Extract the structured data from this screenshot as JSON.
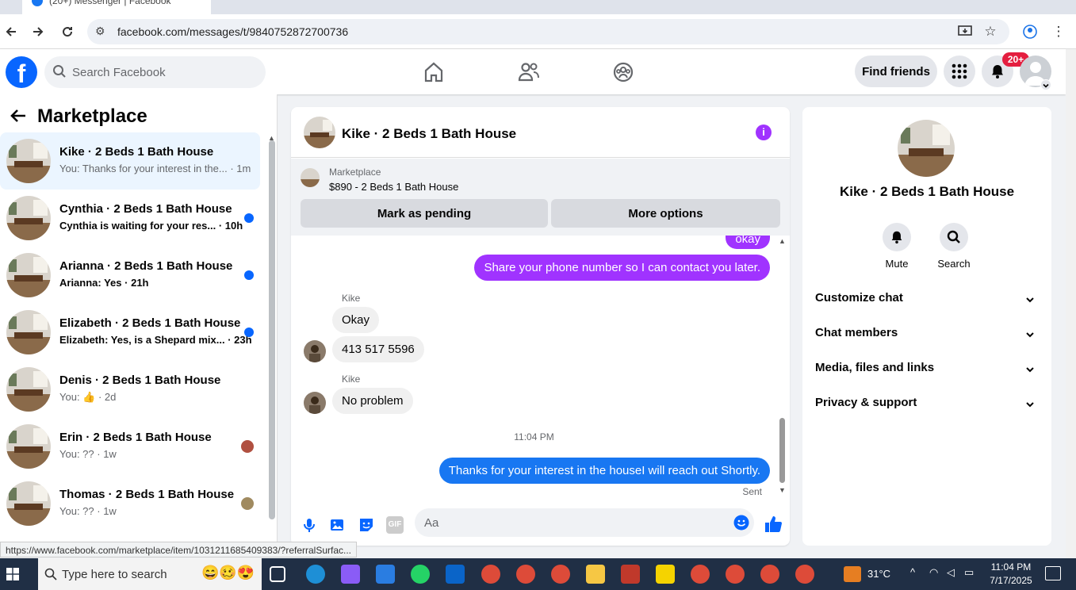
{
  "browser": {
    "tab_title": "(20+) Messenger | Facebook",
    "url": "facebook.com/messages/t/9840752872700736",
    "status_url": "https://www.facebook.com/marketplace/item/1031211685409383/?referralSurfac..."
  },
  "fb_header": {
    "logo": "f",
    "search_placeholder": "Search Facebook",
    "find_friends_label": "Find friends",
    "notification_badge": "20+"
  },
  "left_panel": {
    "title": "Marketplace",
    "conversations": [
      {
        "name": "Kike · 2 Beds 1 Bath House",
        "preview": "You: Thanks for your interest in the...",
        "time": "· 1m",
        "indicator": "none",
        "active": true
      },
      {
        "name": "Cynthia · 2 Beds 1 Bath House",
        "preview": "Cynthia is waiting for your res...",
        "time": "· 10h",
        "indicator": "unread-dot"
      },
      {
        "name": "Arianna · 2 Beds 1 Bath House",
        "preview": "Arianna: Yes",
        "time": "· 21h",
        "indicator": "unread-dot"
      },
      {
        "name": "Elizabeth · 2 Beds 1 Bath House",
        "preview": "Elizabeth: Yes, is a Shepard mix...",
        "time": "· 23h",
        "indicator": "unread-dot"
      },
      {
        "name": "Denis · 2 Beds 1 Bath House",
        "preview": "You: 👍",
        "time": "· 2d",
        "indicator": "none"
      },
      {
        "name": "Erin · 2 Beds 1 Bath House",
        "preview": "You: ??",
        "time": "· 1w",
        "indicator": "seen-avatar"
      },
      {
        "name": "Thomas · 2 Beds 1 Bath House",
        "preview": "You: ??",
        "time": "· 1w",
        "indicator": "seen-avatar"
      }
    ]
  },
  "chat": {
    "title": "Kike · 2 Beds 1 Bath House",
    "info_icon": "i",
    "marketplace_label": "Marketplace",
    "listing": "$890 - 2 Beds 1 Bath House",
    "mark_pending_label": "Mark as pending",
    "more_options_label": "More options",
    "messages": {
      "okay_out": "okay",
      "share_phone": "Share your phone number so I can contact you later.",
      "sender1": "Kike",
      "okay_in": "Okay",
      "phone": "413 517 5596",
      "sender2": "Kike",
      "no_problem": "No problem",
      "timestamp": "11:04 PM",
      "thanks": "Thanks for your interest in the houseI will reach out Shortly.",
      "sent": "Sent"
    },
    "composer_placeholder": "Aa",
    "gif_label": "GIF"
  },
  "right_panel": {
    "name": "Kike · 2 Beds 1 Bath House",
    "mute_label": "Mute",
    "search_label": "Search",
    "sections": [
      "Customize chat",
      "Chat members",
      "Media, files and links",
      "Privacy & support"
    ]
  },
  "taskbar": {
    "search_placeholder": "Type here to search",
    "temperature": "31°C",
    "time": "11:04 PM",
    "date": "7/17/2025"
  },
  "colors": {
    "fb_blue": "#0866ff",
    "messenger_purple": "#a033ff",
    "bubble_blue": "#1877f2"
  }
}
